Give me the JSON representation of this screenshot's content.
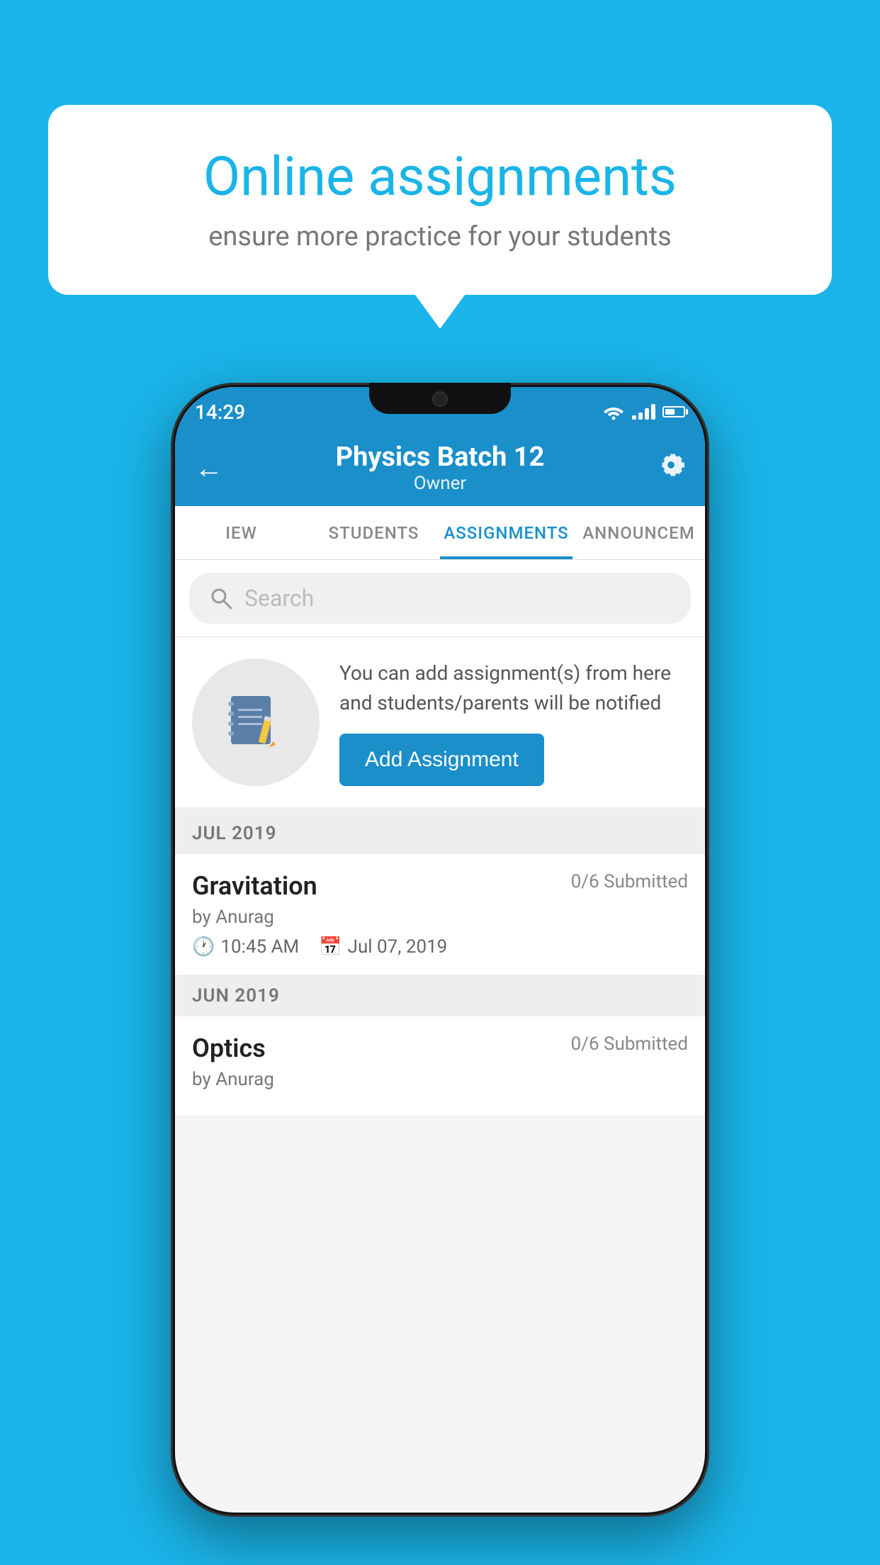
{
  "background_color": "#1ab4e8",
  "promo": {
    "title": "Online assignments",
    "subtitle": "ensure more practice for your students"
  },
  "phone": {
    "status_bar": {
      "time": "14:29"
    },
    "header": {
      "title": "Physics Batch 12",
      "subtitle": "Owner",
      "back_label": "←",
      "settings_label": "⚙"
    },
    "tabs": [
      {
        "label": "IEW",
        "active": false
      },
      {
        "label": "STUDENTS",
        "active": false
      },
      {
        "label": "ASSIGNMENTS",
        "active": true
      },
      {
        "label": "ANNOUNCEM",
        "active": false
      }
    ],
    "search": {
      "placeholder": "Search"
    },
    "info_card": {
      "description": "You can add assignment(s) from here and students/parents will be notified",
      "add_button_label": "Add Assignment"
    },
    "sections": [
      {
        "header": "JUL 2019",
        "assignments": [
          {
            "name": "Gravitation",
            "submitted": "0/6 Submitted",
            "by": "by Anurag",
            "time": "10:45 AM",
            "date": "Jul 07, 2019"
          }
        ]
      },
      {
        "header": "JUN 2019",
        "assignments": [
          {
            "name": "Optics",
            "submitted": "0/6 Submitted",
            "by": "by Anurag",
            "time": "",
            "date": ""
          }
        ]
      }
    ]
  }
}
